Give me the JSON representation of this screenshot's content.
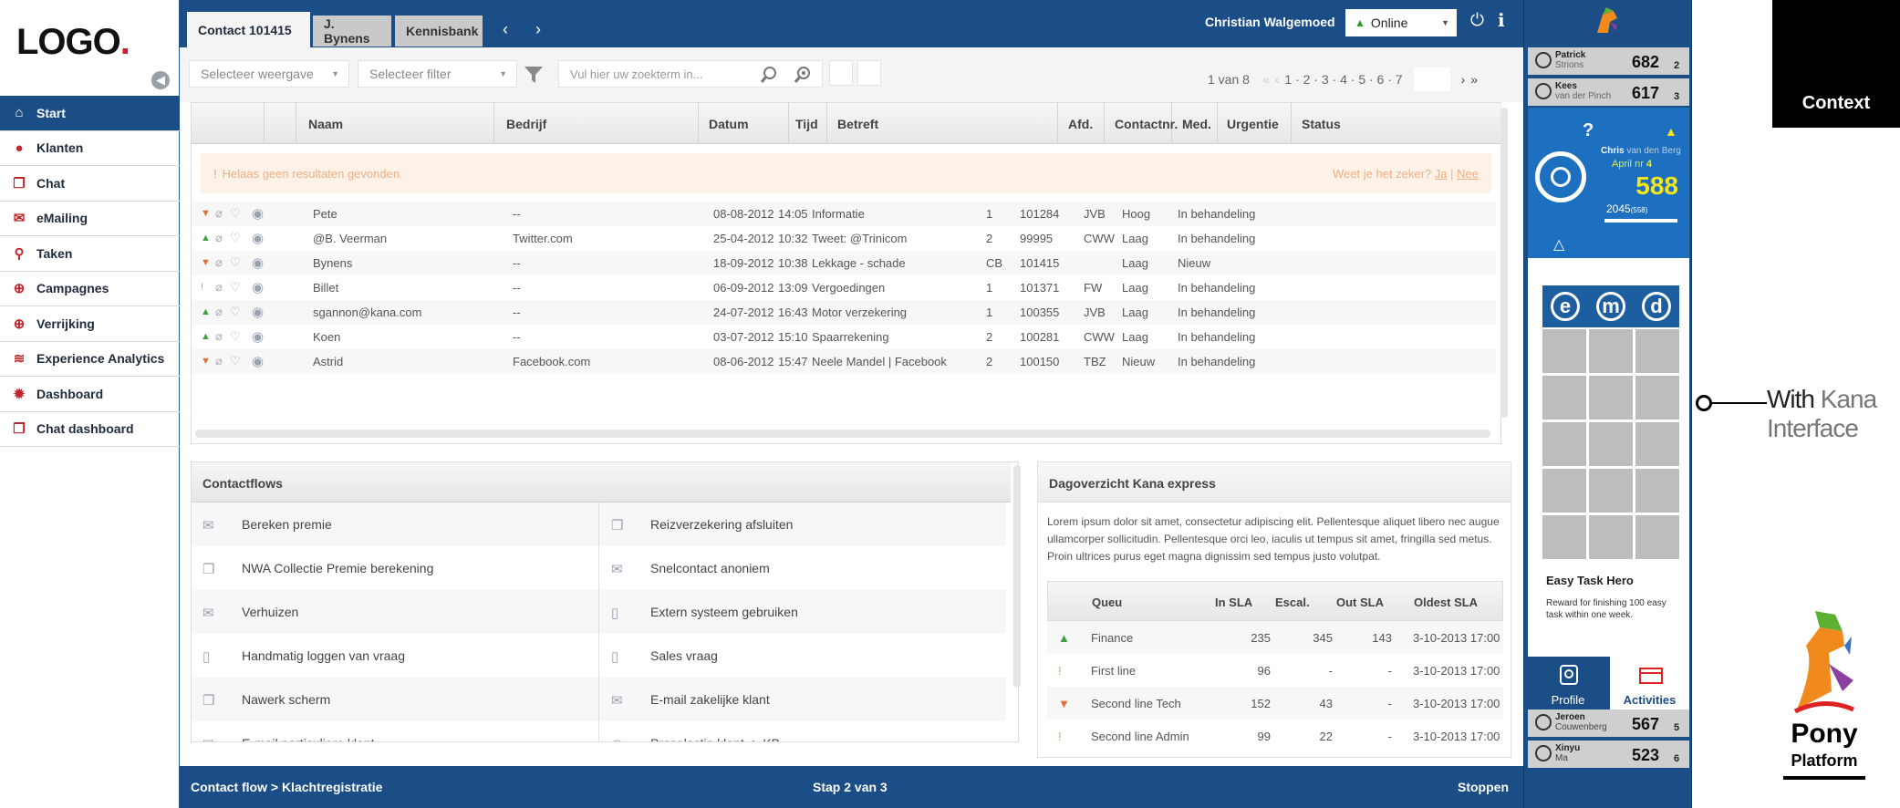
{
  "logo": {
    "text": "LOGO",
    "dot": "."
  },
  "nav": [
    {
      "label": "Start",
      "icon": "home-icon"
    },
    {
      "label": "Klanten",
      "icon": "person-icon"
    },
    {
      "label": "Chat",
      "icon": "chat-icon"
    },
    {
      "label": "eMailing",
      "icon": "mail-icon"
    },
    {
      "label": "Taken",
      "icon": "tasks-icon"
    },
    {
      "label": "Campagnes",
      "icon": "globe-icon"
    },
    {
      "label": "Verrijking",
      "icon": "plus-icon"
    },
    {
      "label": "Experience Analytics",
      "icon": "rss-icon"
    },
    {
      "label": "Dashboard",
      "icon": "gear-icon"
    },
    {
      "label": "Chat dashboard",
      "icon": "chat-icon"
    }
  ],
  "tabs": {
    "contact": "Contact 101415",
    "jbynens": "J. Bynens",
    "kennisbank": "Kennisbank"
  },
  "user": {
    "name": "Christian Walgemoed",
    "status": "Online"
  },
  "toolbar": {
    "view_placeholder": "Selecteer weergave",
    "filter_placeholder": "Selecteer filter",
    "search_placeholder": "Vul hier uw zoekterm in...",
    "page_info": "1 van 8",
    "pages": "1 · 2 · 3 · 4 · 5 · 6 · 7"
  },
  "grid": {
    "columns": [
      "Naam",
      "Bedrijf",
      "Datum",
      "Tijd",
      "Betreft",
      "Afd.",
      "Contactnr.",
      "Med.",
      "Urgentie",
      "Status"
    ],
    "noresult": "Helaas geen resultaten gevonden.",
    "noresult_confirm": "Weet je het zeker?",
    "yes": "Ja",
    "no": "Nee",
    "rows": [
      {
        "marker": "▼",
        "color": "#e07030",
        "naam": "Pete",
        "bedrijf": "--",
        "datum": "08-08-2012",
        "tijd": "14:05",
        "betreft": "Informatie",
        "afd": "1",
        "contactnr": "101284",
        "med": "JVB",
        "urgentie": "Hoog",
        "status": "In behandeling"
      },
      {
        "marker": "▲",
        "color": "#40a040",
        "naam": "@B. Veerman",
        "bedrijf": "Twitter.com",
        "datum": "25-04-2012",
        "tijd": "10:32",
        "betreft": "Tweet: @Trinicom",
        "afd": "2",
        "contactnr": "99995",
        "med": "CWW",
        "urgentie": "Laag",
        "status": "In behandeling"
      },
      {
        "marker": "▼",
        "color": "#e07030",
        "naam": "Bynens",
        "bedrijf": "--",
        "datum": "18-09-2012",
        "tijd": "10:38",
        "betreft": "Lekkage - schade",
        "afd": "CB",
        "contactnr": "101415",
        "med": "",
        "urgentie": "Laag",
        "status": "Nieuw"
      },
      {
        "marker": "!",
        "color": "#e0a030",
        "naam": "Billet",
        "bedrijf": "--",
        "datum": "06-09-2012",
        "tijd": "13:09",
        "betreft": "Vergoedingen",
        "afd": "1",
        "contactnr": "101371",
        "med": "FW",
        "urgentie": "Laag",
        "status": "In behandeling"
      },
      {
        "marker": "▲",
        "color": "#40a040",
        "naam": "sgannon@kana.com",
        "bedrijf": "--",
        "datum": "24-07-2012",
        "tijd": "16:43",
        "betreft": "Motor verzekering",
        "afd": "1",
        "contactnr": "100355",
        "med": "JVB",
        "urgentie": "Laag",
        "status": "In behandeling"
      },
      {
        "marker": "▲",
        "color": "#40a040",
        "naam": "Koen",
        "bedrijf": "--",
        "datum": "03-07-2012",
        "tijd": "15:10",
        "betreft": "Spaarrekening",
        "afd": "2",
        "contactnr": "100281",
        "med": "CWW",
        "urgentie": "Laag",
        "status": "In behandeling"
      },
      {
        "marker": "▼",
        "color": "#e07030",
        "naam": "Astrid",
        "bedrijf": "Facebook.com",
        "datum": "08-06-2012",
        "tijd": "15:47",
        "betreft": "Neele Mandel | Facebook",
        "afd": "2",
        "contactnr": "100150",
        "med": "TBZ",
        "urgentie": "Nieuw",
        "status": "In behandeling"
      }
    ]
  },
  "contactflows": {
    "title": "Contactflows",
    "left": [
      "Bereken premie",
      "NWA Collectie Premie berekening",
      "Verhuizen",
      "Handmatig loggen van vraag",
      "Nawerk scherm",
      "E-mail particuliere klant"
    ],
    "right": [
      "Reizverzekering afsluiten",
      "Snelcontact anoniem",
      "Extern systeem gebruiken",
      "Sales vraag",
      "E-mail zakelijke klant",
      "Preselectie klant -> KB"
    ]
  },
  "dagoverzicht": {
    "title": "Dagoverzicht Kana express",
    "text": "Lorem ipsum dolor sit amet, consectetur adipiscing elit. Pellentesque aliquet libero nec augue ullamcorper sollicitudin. Pellentesque orci leo, iaculis ut tempus sit amet, fringilla sed metus. Proin ultrices purus eget magna dignissim sed tempus justo volutpat.",
    "columns": [
      "Queu",
      "In SLA",
      "Escal.",
      "Out SLA",
      "Oldest SLA"
    ],
    "rows": [
      {
        "marker": "▲",
        "color": "#40a040",
        "queu": "Finance",
        "insla": "235",
        "escal": "345",
        "outsla": "143",
        "oldest": "3-10-2013 17:00"
      },
      {
        "marker": "!",
        "color": "#e0a030",
        "queu": "First line",
        "insla": "96",
        "escal": "-",
        "outsla": "-",
        "oldest": "3-10-2013 17:00"
      },
      {
        "marker": "▼",
        "color": "#e07030",
        "queu": "Second line Tech",
        "insla": "152",
        "escal": "43",
        "outsla": "-",
        "oldest": "3-10-2013 17:00"
      },
      {
        "marker": "!",
        "color": "#e0a030",
        "queu": "Second line Admin",
        "insla": "99",
        "escal": "22",
        "outsla": "-",
        "oldest": "3-10-2013 17:00"
      }
    ]
  },
  "footer": {
    "breadcrumb": "Contact flow > Klachtregistratie",
    "step": "Stap 2 van 3",
    "stop": "Stoppen"
  },
  "leaderboard": {
    "top": [
      {
        "first": "Patrick",
        "last": "Strions",
        "score": "682",
        "rank": "2"
      },
      {
        "first": "Kees",
        "last": "van der Pinch",
        "score": "617",
        "rank": "3"
      }
    ],
    "me": {
      "first": "Chris",
      "last": "van den Berg",
      "month": "April",
      "rank": "4",
      "score": "588",
      "points": "2045",
      "points_max": "(558)"
    },
    "bottom": [
      {
        "first": "Jeroen",
        "last": "Couwenberg",
        "score": "567",
        "rank": "5"
      },
      {
        "first": "Xinyu",
        "last": "Ma",
        "score": "523",
        "rank": "6"
      }
    ]
  },
  "badges": {
    "letters": [
      "e",
      "m",
      "d"
    ],
    "hero_title": "Easy Task Hero",
    "hero_desc": "Reward for finishing 100 easy task within one week."
  },
  "panel_tabs": {
    "profile": "Profile",
    "activities": "Activities"
  },
  "annotations": {
    "context": "Context",
    "with": "With",
    "kana": "Kana",
    "interface": "Interface",
    "pony": "Pony",
    "platform": "Platform"
  }
}
